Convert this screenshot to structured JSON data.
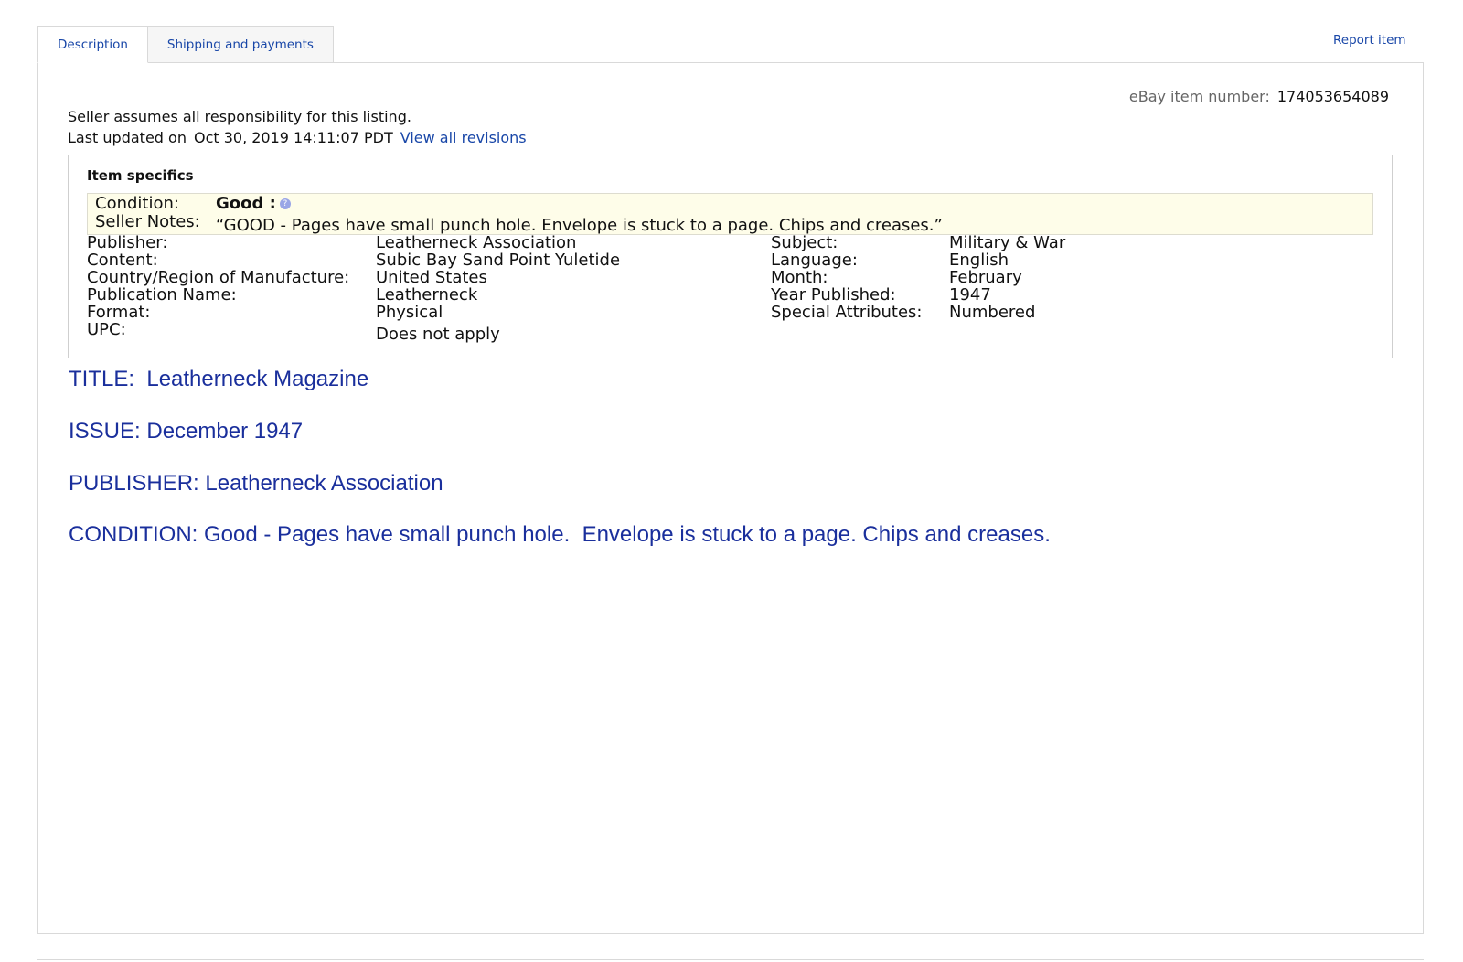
{
  "tabs": [
    {
      "label": "Description"
    },
    {
      "label": "Shipping and payments"
    }
  ],
  "report_item": "Report item",
  "item_number": {
    "label": "eBay item number:",
    "value": "174053654089"
  },
  "responsibility": "Seller assumes all responsibility for this listing.",
  "last_updated": {
    "label": "Last updated on",
    "value": "Oct 30, 2019 14:11:07 PDT",
    "link": "View all revisions"
  },
  "item_specifics": {
    "title": "Item specifics",
    "condition_label": "Condition:",
    "condition_value": "Good :",
    "seller_notes_label": "Seller Notes:",
    "seller_notes_value": "“GOOD - Pages have small punch hole. Envelope is stuck to a page. Chips and creases.”",
    "left": [
      {
        "label": "Publisher:",
        "value": "Leatherneck Association"
      },
      {
        "label": "Content:",
        "value": "Subic Bay Sand Point Yuletide"
      },
      {
        "label": "Country/Region of Manufacture:",
        "value": "United States"
      },
      {
        "label": "Publication Name:",
        "value": "Leatherneck"
      },
      {
        "label": "Format:",
        "value": "Physical"
      },
      {
        "label": "UPC:",
        "value": "Does not apply"
      }
    ],
    "right": [
      {
        "label": "Subject:",
        "value": "Military & War"
      },
      {
        "label": "Language:",
        "value": "English"
      },
      {
        "label": "Month:",
        "value": "February"
      },
      {
        "label": "Year Published:",
        "value": "1947"
      },
      {
        "label": "Special Attributes:",
        "value": "Numbered"
      }
    ]
  },
  "description": [
    "TITLE:  Leatherneck Magazine",
    "ISSUE: December 1947",
    "PUBLISHER: Leatherneck Association",
    "CONDITION: Good - Pages have small punch hole.  Envelope is stuck to a page. Chips and creases."
  ],
  "colors": {
    "link": "#1947a8",
    "description_text": "#1a2f9c",
    "condition_bg": "#fefde9"
  }
}
